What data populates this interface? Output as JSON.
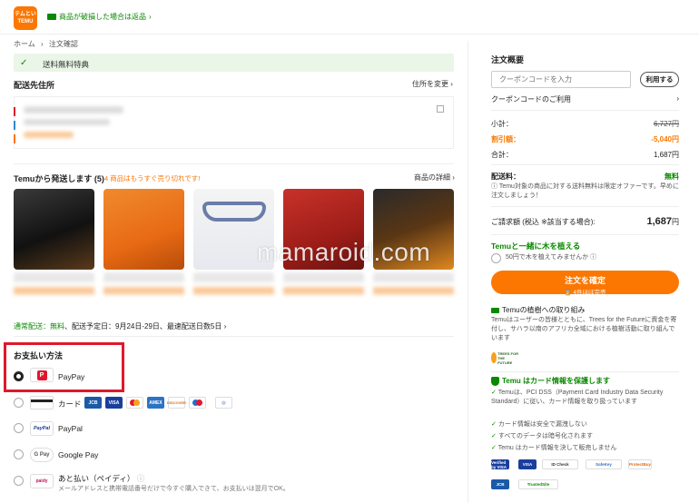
{
  "header": {
    "logo_text": "テムとい\nTEMU",
    "returns_text": "商品が破損した場合は返品"
  },
  "breadcrumb": {
    "home": "ホーム",
    "sep": "›",
    "current": "注文確認"
  },
  "banner": {
    "text": "送料無料特典"
  },
  "address": {
    "title": "配送先住所",
    "change_link": "住所を変更"
  },
  "shipment": {
    "title": "Temuから発送します (5)",
    "warning": "4 商品はもうすぐ売り切れです!",
    "details_link": "商品の詳細",
    "delivery_text": "通常配送：",
    "delivery_free": "無料",
    "delivery_rest": "、配送予定日：9月24日-29日、最速配送日数5日"
  },
  "payment": {
    "title": "お支払い方法",
    "options": [
      {
        "label": "PayPay",
        "logo": "PayPay",
        "selected": true
      },
      {
        "label": "カード",
        "logo": "card-icon",
        "selected": false
      },
      {
        "label": "PayPal",
        "logo": "PayPal",
        "selected": false
      },
      {
        "label": "Google Pay",
        "logo": "G Pay",
        "selected": false
      },
      {
        "label": "あと払い（ペイディ）",
        "logo": "paidy",
        "selected": false,
        "sub": "メールアドレスと携帯電話番号だけで今すぐ購入できて、お支払いは翌月でOK。"
      }
    ],
    "card_brands": [
      "JCB",
      "VISA",
      "MC",
      "AMEX",
      "DISCOVER",
      "Maestro",
      "Diners"
    ]
  },
  "summary": {
    "title": "注文概要",
    "coupon_placeholder": "クーポンコードを入力",
    "apply_label": "利用する",
    "coupon_link": "クーポンコードのご利用",
    "subtotal_label": "小計：",
    "subtotal_value": "6,727円",
    "discount_label": "割引額：",
    "discount_value": "-5,040円",
    "total_label": "合計：",
    "total_value": "1,687円",
    "shipping_label": "配送料：",
    "shipping_value": "無料",
    "shipping_note": "Temu対象の商品に対する送料無料は限定オファーです。早めに注文しましょう！",
    "billing_label": "ご請求額 (税込 ※該当する場合):",
    "billing_value": "1,687",
    "billing_unit": "円",
    "tree_title": "Temuと一緒に木を植える",
    "tree_option": "50円で木を植えてみませんか",
    "cta_label": "注文を確定",
    "cta_sub": "4件ほぼ完売",
    "planting_title": "Temuの植樹への取り組み",
    "planting_text": "Temuはユーザーの皆様とともに、Trees for the Futureに資金を寄付し、サハラ以南のアフリカ全域における植樹活動に取り組んでいます",
    "trees_logo": "TREES FOR THE FUTURE",
    "security_title": "Temu はカード情報を保護します",
    "security_items": [
      "Temuは、PCI DSS（Payment Card Industry Data Security Standard）に従い、カード情報を取り扱っています",
      "カード情報は安全で漏洩しない",
      "すべてのデータは暗号化されます",
      "Temu はカード情報を決して販売しません"
    ],
    "badges": [
      "Verified by VISA",
      "ID Check",
      "SafeKey",
      "ProtectBuy",
      "JCB",
      "TrustedSite"
    ]
  },
  "watermark": "mamaroid.com",
  "colors": {
    "brand": "#fb7701",
    "green": "#0a8800",
    "highlight": "#e0182d"
  }
}
